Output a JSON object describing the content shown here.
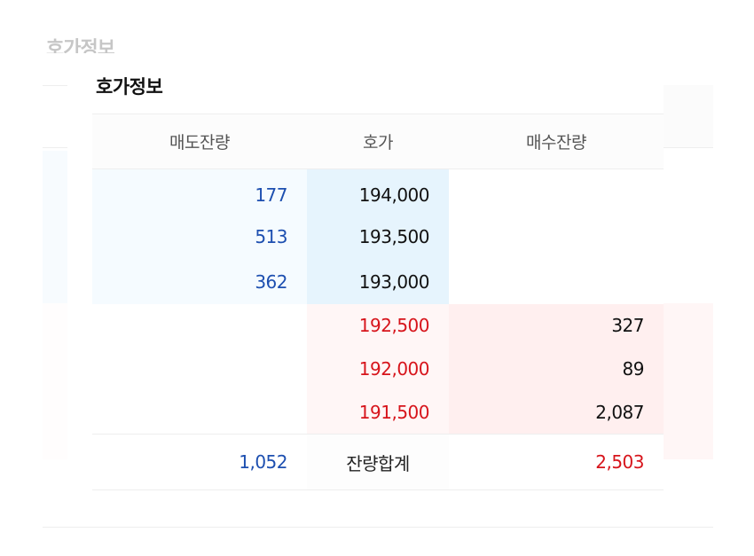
{
  "background": {
    "title": "호가정보"
  },
  "panel": {
    "title": "호가정보",
    "headers": {
      "ask": "매도잔량",
      "price": "호가",
      "bid": "매수잔량"
    },
    "asks": [
      {
        "qty": "177",
        "price": "194,000"
      },
      {
        "qty": "513",
        "price": "193,500"
      },
      {
        "qty": "362",
        "price": "193,000"
      }
    ],
    "bids": [
      {
        "price": "192,500",
        "qty": "327"
      },
      {
        "price": "192,000",
        "qty": "89"
      },
      {
        "price": "191,500",
        "qty": "2,087"
      }
    ],
    "total": {
      "ask": "1,052",
      "label": "잔량합계",
      "bid": "2,503"
    }
  },
  "colors": {
    "ask_text": "#1d4fb0",
    "bid_text": "#d7141b",
    "ask_bg": "#e6f4fd",
    "bid_bg": "#ffefef"
  }
}
